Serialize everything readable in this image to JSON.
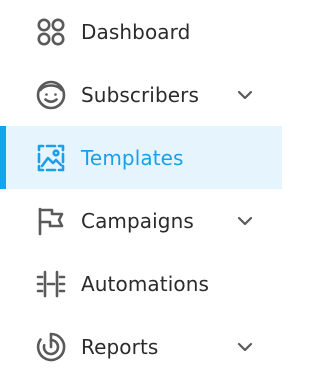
{
  "colors": {
    "text": "#2b2b2b",
    "icon": "#5a5a5a",
    "active_text": "#1aa0e8",
    "active_bg": "#e5f4fd",
    "active_bar": "#10a5ec"
  },
  "nav": {
    "items": [
      {
        "label": "Dashboard",
        "icon": "dashboard-icon",
        "has_chevron": false,
        "active": false
      },
      {
        "label": "Subscribers",
        "icon": "subscribers-icon",
        "has_chevron": true,
        "active": false
      },
      {
        "label": "Templates",
        "icon": "templates-icon",
        "has_chevron": false,
        "active": true
      },
      {
        "label": "Campaigns",
        "icon": "campaigns-flag-icon",
        "has_chevron": true,
        "active": false
      },
      {
        "label": "Automations",
        "icon": "automations-icon",
        "has_chevron": false,
        "active": false
      },
      {
        "label": "Reports",
        "icon": "reports-icon",
        "has_chevron": true,
        "active": false
      }
    ]
  }
}
